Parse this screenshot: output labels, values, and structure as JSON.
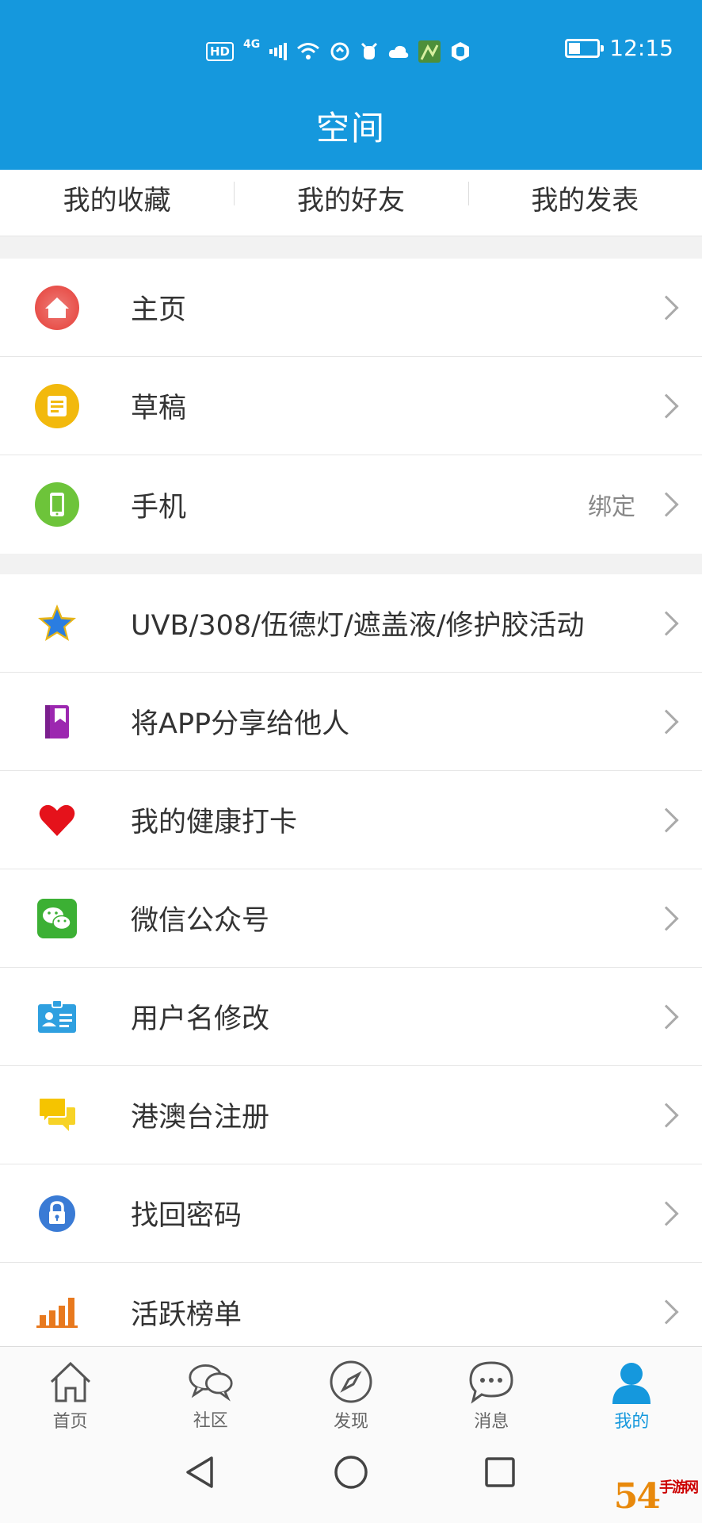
{
  "status_bar": {
    "hd": "HD",
    "network": "4G",
    "time": "12:15"
  },
  "header": {
    "title": "空间"
  },
  "top_tabs": [
    {
      "label": "我的收藏"
    },
    {
      "label": "我的好友"
    },
    {
      "label": "我的发表"
    }
  ],
  "group1": [
    {
      "label": "主页",
      "icon": "home-icon",
      "value": ""
    },
    {
      "label": "草稿",
      "icon": "draft-icon",
      "value": ""
    },
    {
      "label": "手机",
      "icon": "phone-icon",
      "value": "绑定"
    }
  ],
  "group2": [
    {
      "label": "UVB/308/伍德灯/遮盖液/修护胶活动",
      "icon": "star-icon"
    },
    {
      "label": "将APP分享给他人",
      "icon": "bookmark-icon"
    },
    {
      "label": "我的健康打卡",
      "icon": "heart-icon"
    },
    {
      "label": "微信公众号",
      "icon": "wechat-icon"
    },
    {
      "label": "用户名修改",
      "icon": "id-card-icon"
    },
    {
      "label": "港澳台注册",
      "icon": "chat-bubbles-icon"
    },
    {
      "label": "找回密码",
      "icon": "lock-icon"
    },
    {
      "label": "活跃榜单",
      "icon": "bar-chart-icon"
    }
  ],
  "bottom_nav": [
    {
      "label": "首页",
      "icon": "home-outline-icon",
      "active": false
    },
    {
      "label": "社区",
      "icon": "community-icon",
      "active": false
    },
    {
      "label": "发现",
      "icon": "compass-icon",
      "active": false
    },
    {
      "label": "消息",
      "icon": "message-icon",
      "active": false
    },
    {
      "label": "我的",
      "icon": "user-icon",
      "active": true
    }
  ],
  "colors": {
    "primary": "#1598dd",
    "home_icon": "#e8504a",
    "draft_icon": "#f2b90d",
    "phone_icon": "#6dc43a",
    "heart_icon": "#e5121b",
    "wechat_icon": "#3cb034",
    "lock_icon": "#3a7bd5",
    "chart_icon": "#e8791e"
  },
  "watermark": {
    "brand": "54",
    "site": "手游网"
  }
}
